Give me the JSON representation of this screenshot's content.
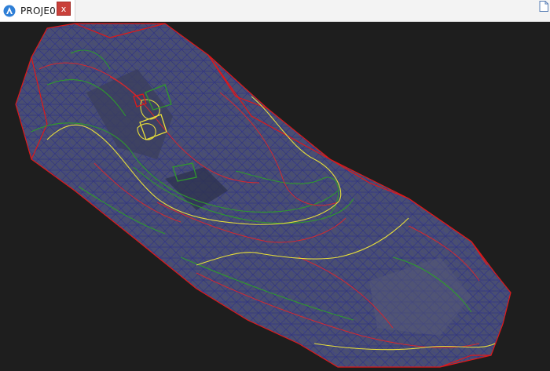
{
  "tab": {
    "title": "PROJE0",
    "close_label": "x"
  },
  "colors": {
    "background": "#1e1e1e",
    "mesh": "#2b2f84",
    "terrain": "#4a4f70",
    "boundary": "#e01818",
    "contour_red": "#d4282e",
    "contour_green": "#2f9a2a",
    "contour_yellow": "#e8df3a",
    "close_button": "#c9403a",
    "app_icon": "#2f7fd6"
  },
  "icons": {
    "app": "app-logo-icon",
    "close": "close-icon",
    "corner": "document-icon"
  }
}
